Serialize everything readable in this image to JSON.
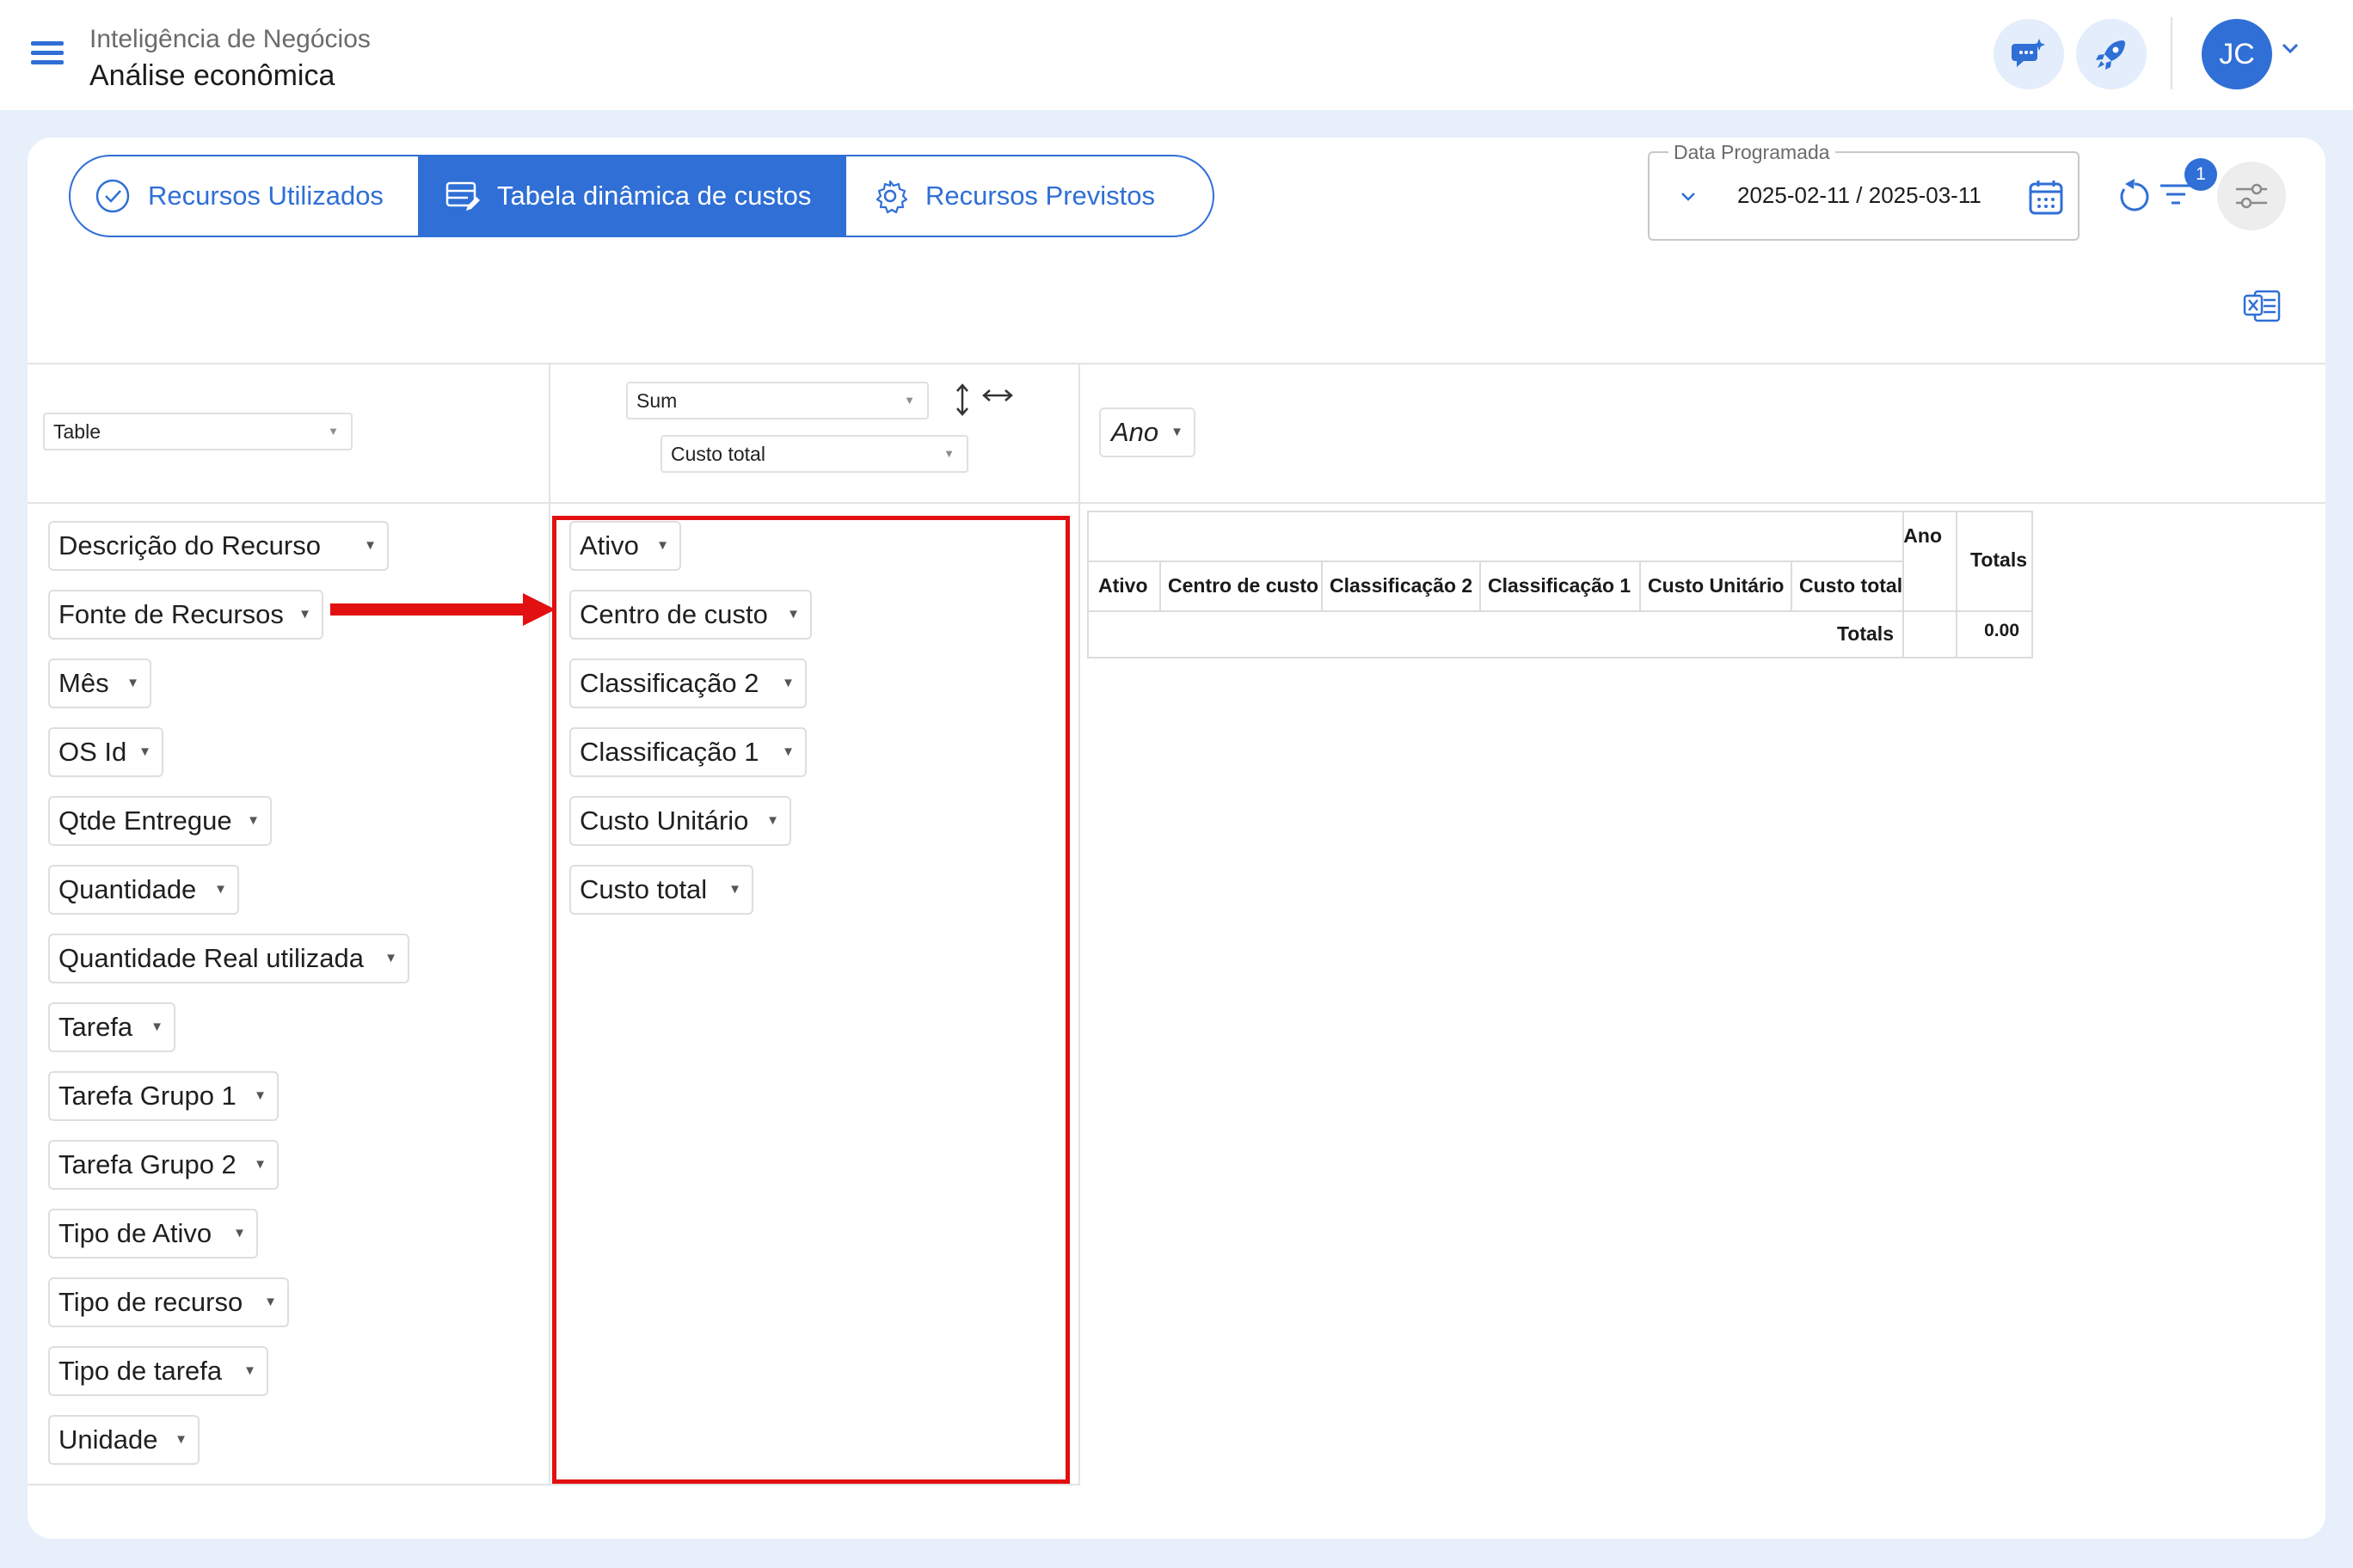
{
  "header": {
    "app_subtitle": "Inteligência de Negócios",
    "page_title": "Análise econômica",
    "avatar_initials": "JC"
  },
  "tabs": [
    {
      "label": "Recursos Utilizados",
      "icon": "check-circle-icon",
      "active": false
    },
    {
      "label": "Tabela dinâmica de custos",
      "icon": "table-edit-icon",
      "active": true
    },
    {
      "label": "Recursos Previstos",
      "icon": "gear-icon",
      "active": false
    }
  ],
  "date_filter": {
    "label": "Data Programada",
    "value": "2025-02-11 / 2025-03-11"
  },
  "filter_badge": "1",
  "pivot": {
    "renderer": "Table",
    "aggregator": "Sum",
    "value_field": "Custo total",
    "column_field": "Ano",
    "unused_attributes": [
      "Descrição do Recurso",
      "Fonte de Recursos",
      "Mês",
      "OS Id",
      "Qtde Entregue",
      "Quantidade",
      "Quantidade Real utilizada",
      "Tarefa",
      "Tarefa Grupo 1",
      "Tarefa Grupo 2",
      "Tipo de Ativo",
      "Tipo de recurso",
      "Tipo de tarefa",
      "Unidade"
    ],
    "row_attributes": [
      "Ativo",
      "Centro de custo",
      "Classificação 2",
      "Classificação 1",
      "Custo Unitário",
      "Custo total"
    ]
  },
  "result_table": {
    "col_header": "Ano",
    "totals_label": "Totals",
    "row_headers": [
      "Ativo",
      "Centro de custo",
      "Classificação 2",
      "Classificação 1",
      "Custo Unitário",
      "Custo total"
    ],
    "totals_row_label": "Totals",
    "grand_total": "0.00"
  },
  "colors": {
    "primary": "#2f6fd6",
    "annotation": "#e21010",
    "background": "#e6effa"
  }
}
